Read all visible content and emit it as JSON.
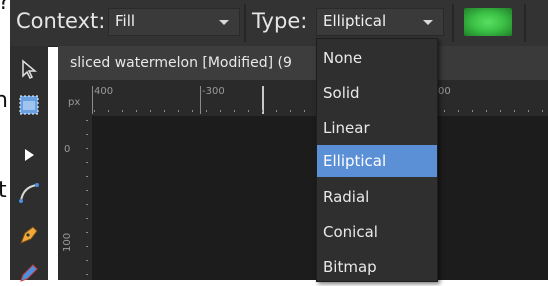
{
  "context_bar": {
    "context_label": "Context:",
    "context_value": "Fill",
    "type_label": "Type:",
    "type_value": "Elliptical",
    "fill_color": "#3cc246"
  },
  "document": {
    "tab_title": "sliced watermelon [Modified] (9"
  },
  "rulers": {
    "unit": "px",
    "horizontal_ticks": [
      "400",
      "-300",
      "00"
    ],
    "vertical_ticks": [
      "0",
      "100"
    ]
  },
  "type_menu": {
    "items": [
      "None",
      "Solid",
      "Linear",
      "Elliptical",
      "Radial",
      "Conical",
      "Bitmap"
    ],
    "selected": "Elliptical"
  },
  "tools": [
    "pointer-icon",
    "frame-icon",
    "node-arrow-icon",
    "corner-tool-icon",
    "pen-icon",
    "pencil-icon"
  ],
  "colors": {
    "toolbar_bg": "#333333",
    "menu_bg": "#2f2f2f",
    "selection": "#5b8fd6",
    "canvas_bg": "#1c1c1c"
  }
}
